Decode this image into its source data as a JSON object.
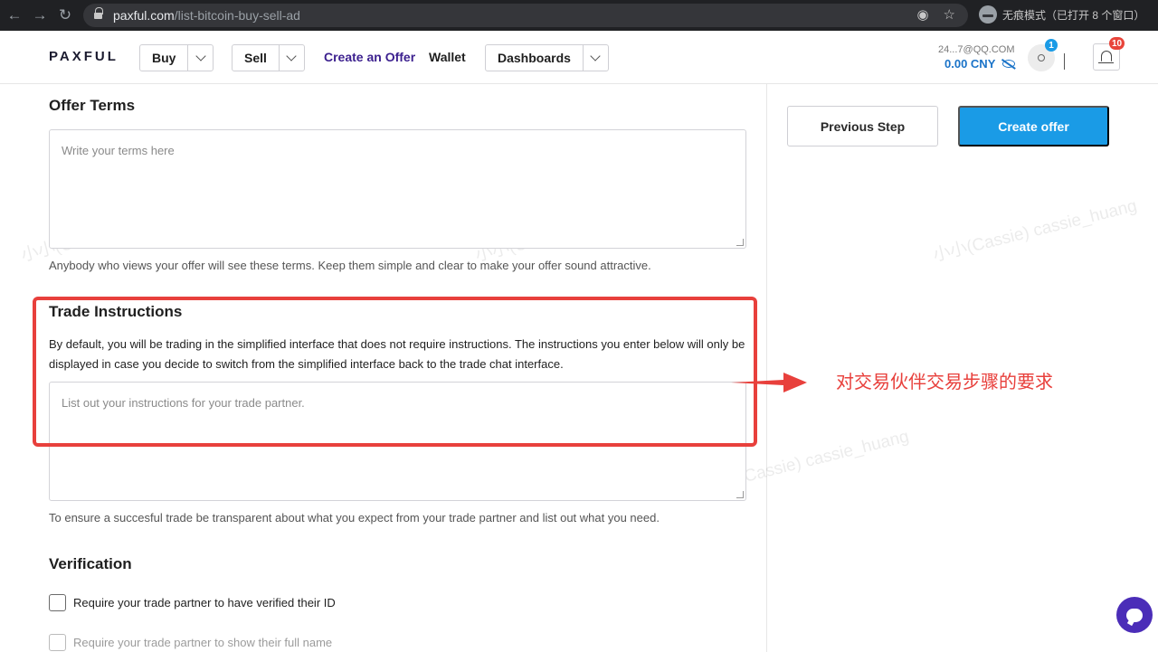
{
  "browser": {
    "url_host": "paxful.com",
    "url_path": "/list-bitcoin-buy-sell-ad",
    "incognito_label": "无痕模式（已打开 8 个窗口）"
  },
  "header": {
    "logo": "PAXFUL",
    "buy_label": "Buy",
    "sell_label": "Sell",
    "create_offer_link": "Create an Offer",
    "wallet_link": "Wallet",
    "dashboards_label": "Dashboards",
    "account_email": "24...7@QQ.COM",
    "account_balance": "0.00 CNY",
    "profile_badge": "1",
    "notifications_badge": "10"
  },
  "offer_terms": {
    "title": "Offer Terms",
    "placeholder": "Write your terms here",
    "helper": "Anybody who views your offer will see these terms. Keep them simple and clear to make your offer sound attractive."
  },
  "trade_instructions": {
    "title": "Trade Instructions",
    "description": "By default, you will be trading in the simplified interface that does not require instructions. The instructions you enter below will only be displayed in case you decide to switch from the simplified interface back to the trade chat interface.",
    "placeholder": "List out your instructions for your trade partner.",
    "helper": "To ensure a succesful trade be transparent about what you expect from your trade partner and list out what you need."
  },
  "verification": {
    "title": "Verification",
    "options": [
      "Require your trade partner to have verified their ID",
      "Require your trade partner to show their full name"
    ]
  },
  "actions": {
    "previous_step": "Previous Step",
    "create_offer": "Create offer"
  },
  "annotation": {
    "text": "对交易伙伴交易步骤的要求",
    "color": "#e8403c"
  },
  "watermark": "小小(Cassie) cassie_huang",
  "colors": {
    "accent": "#1a9be6",
    "link_purple": "#3b1f8e",
    "chat_purple": "#4b2db8"
  }
}
